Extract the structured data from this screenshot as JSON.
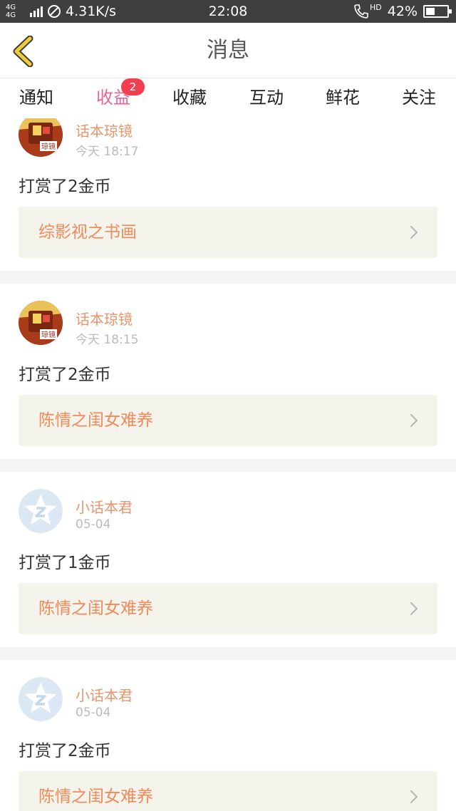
{
  "status_bar": {
    "network": "4G 4G",
    "speed": "4.31K/s",
    "time": "22:08",
    "hd": "HD",
    "battery": "42%",
    "battery_level": 0.42
  },
  "header": {
    "title": "消息",
    "back_icon": "chevron-left-icon",
    "accent_color": "#f2cc3a"
  },
  "tabs": [
    {
      "label": "通知"
    },
    {
      "label": "收益",
      "active": true,
      "badge": "2"
    },
    {
      "label": "收藏"
    },
    {
      "label": "互动"
    },
    {
      "label": "鲜花"
    },
    {
      "label": "关注"
    }
  ],
  "colors": {
    "active_tab": "#e8659b",
    "badge": "#f23f50",
    "name": "#e9946a",
    "book_title": "#f08a58",
    "link_bg": "#f4f3ec"
  },
  "messages": [
    {
      "user": "话本琼镜",
      "time": "今天 18:17",
      "text": "打赏了2金币",
      "book": "综影视之书画",
      "avatar": "artwork-avatar"
    },
    {
      "user": "话本琼镜",
      "time": "今天 18:15",
      "text": "打赏了2金币",
      "book": "陈情之闺女难养",
      "avatar": "artwork-avatar"
    },
    {
      "user": "小话本君",
      "time": "05-04",
      "text": "打赏了1金币",
      "book": "陈情之闺女难养",
      "avatar": "star-avatar"
    },
    {
      "user": "小话本君",
      "time": "05-04",
      "text": "打赏了2金币",
      "book": "陈情之闺女难养",
      "avatar": "star-avatar"
    }
  ]
}
